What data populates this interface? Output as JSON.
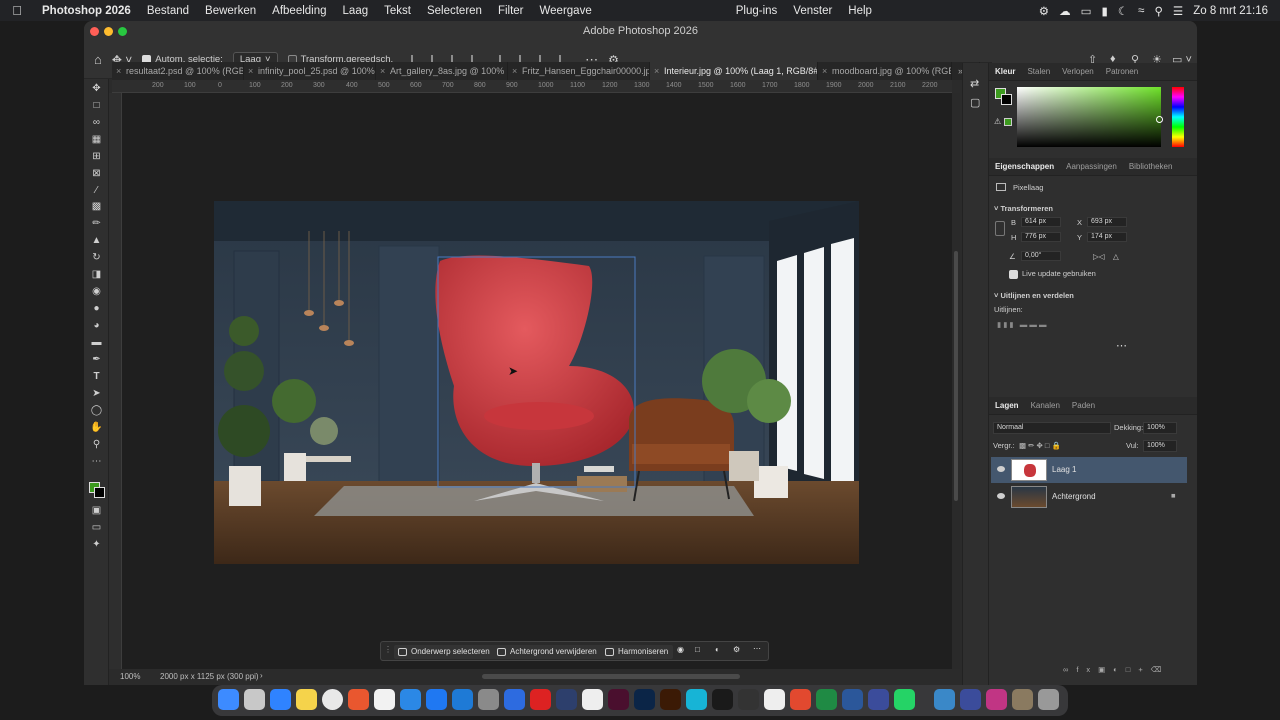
{
  "menubar": {
    "app": "Photoshop 2026",
    "items": [
      "Bestand",
      "Bewerken",
      "Afbeelding",
      "Laag",
      "Tekst",
      "Selecteren",
      "Filter",
      "Weergave"
    ],
    "right_items": [
      "Plug-ins",
      "Venster",
      "Help"
    ],
    "clock": "Zo 8 mrt  21:16"
  },
  "window": {
    "title": "Adobe Photoshop 2026"
  },
  "options": {
    "auto_select_label": "Autom. selectie:",
    "auto_select_value": "Laag",
    "transform_label": "Transform.gereedsch."
  },
  "tabs": [
    {
      "label": "resultaat2.psd @ 100% (RGB..."
    },
    {
      "label": "infinity_pool_25.psd @ 100%..."
    },
    {
      "label": "Art_gallery_8as.jpg @ 100% (..."
    },
    {
      "label": "Fritz_Hansen_Eggchair00000.jpg"
    },
    {
      "label": "Interieur.jpg @ 100% (Laag 1, RGB/8#) *"
    },
    {
      "label": "moodboard.jpg @ 100% (RGB..."
    }
  ],
  "ruler_ticks": [
    "200",
    "100",
    "0",
    "100",
    "200",
    "300",
    "400",
    "500",
    "600",
    "700",
    "800",
    "900",
    "1000",
    "1100",
    "1200",
    "1300",
    "1400",
    "1500",
    "1600",
    "1700",
    "1800",
    "1900",
    "2000",
    "2100",
    "2200"
  ],
  "status": {
    "zoom": "100%",
    "doc_info": "2000 px x 1125 px (300 ppi)"
  },
  "context_bar": {
    "select_subject": "Onderwerp selecteren",
    "remove_bg": "Achtergrond verwijderen",
    "harmonize": "Harmoniseren"
  },
  "panels": {
    "color_tabs": [
      "Kleur",
      "Stalen",
      "Verlopen",
      "Patronen"
    ],
    "foreground_color": "#3c9a1e",
    "picker_hue": "#6fe22a",
    "props_tabs": [
      "Eigenschappen",
      "Aanpassingen",
      "Bibliotheken"
    ],
    "pixel_layer": "Pixellaag",
    "transform_title": "Transformeren",
    "w_label": "B",
    "w": "614 px",
    "h_label": "H",
    "h": "776 px",
    "x_label": "X",
    "x": "693 px",
    "y_label": "Y",
    "y": "174 px",
    "angle": "0,00°",
    "live_update": "Live update gebruiken",
    "align_title": "Uitlijnen en verdelen",
    "align_label": "Uitlijnen:",
    "layers_tabs": [
      "Lagen",
      "Kanalen",
      "Paden"
    ],
    "blend_mode": "Normaal",
    "opacity_label": "Dekking:",
    "opacity": "100%",
    "lock_label": "Vergr.:",
    "fill_label": "Vul:",
    "fill": "100%",
    "layers": [
      {
        "name": "Laag 1"
      },
      {
        "name": "Achtergrond"
      }
    ]
  }
}
